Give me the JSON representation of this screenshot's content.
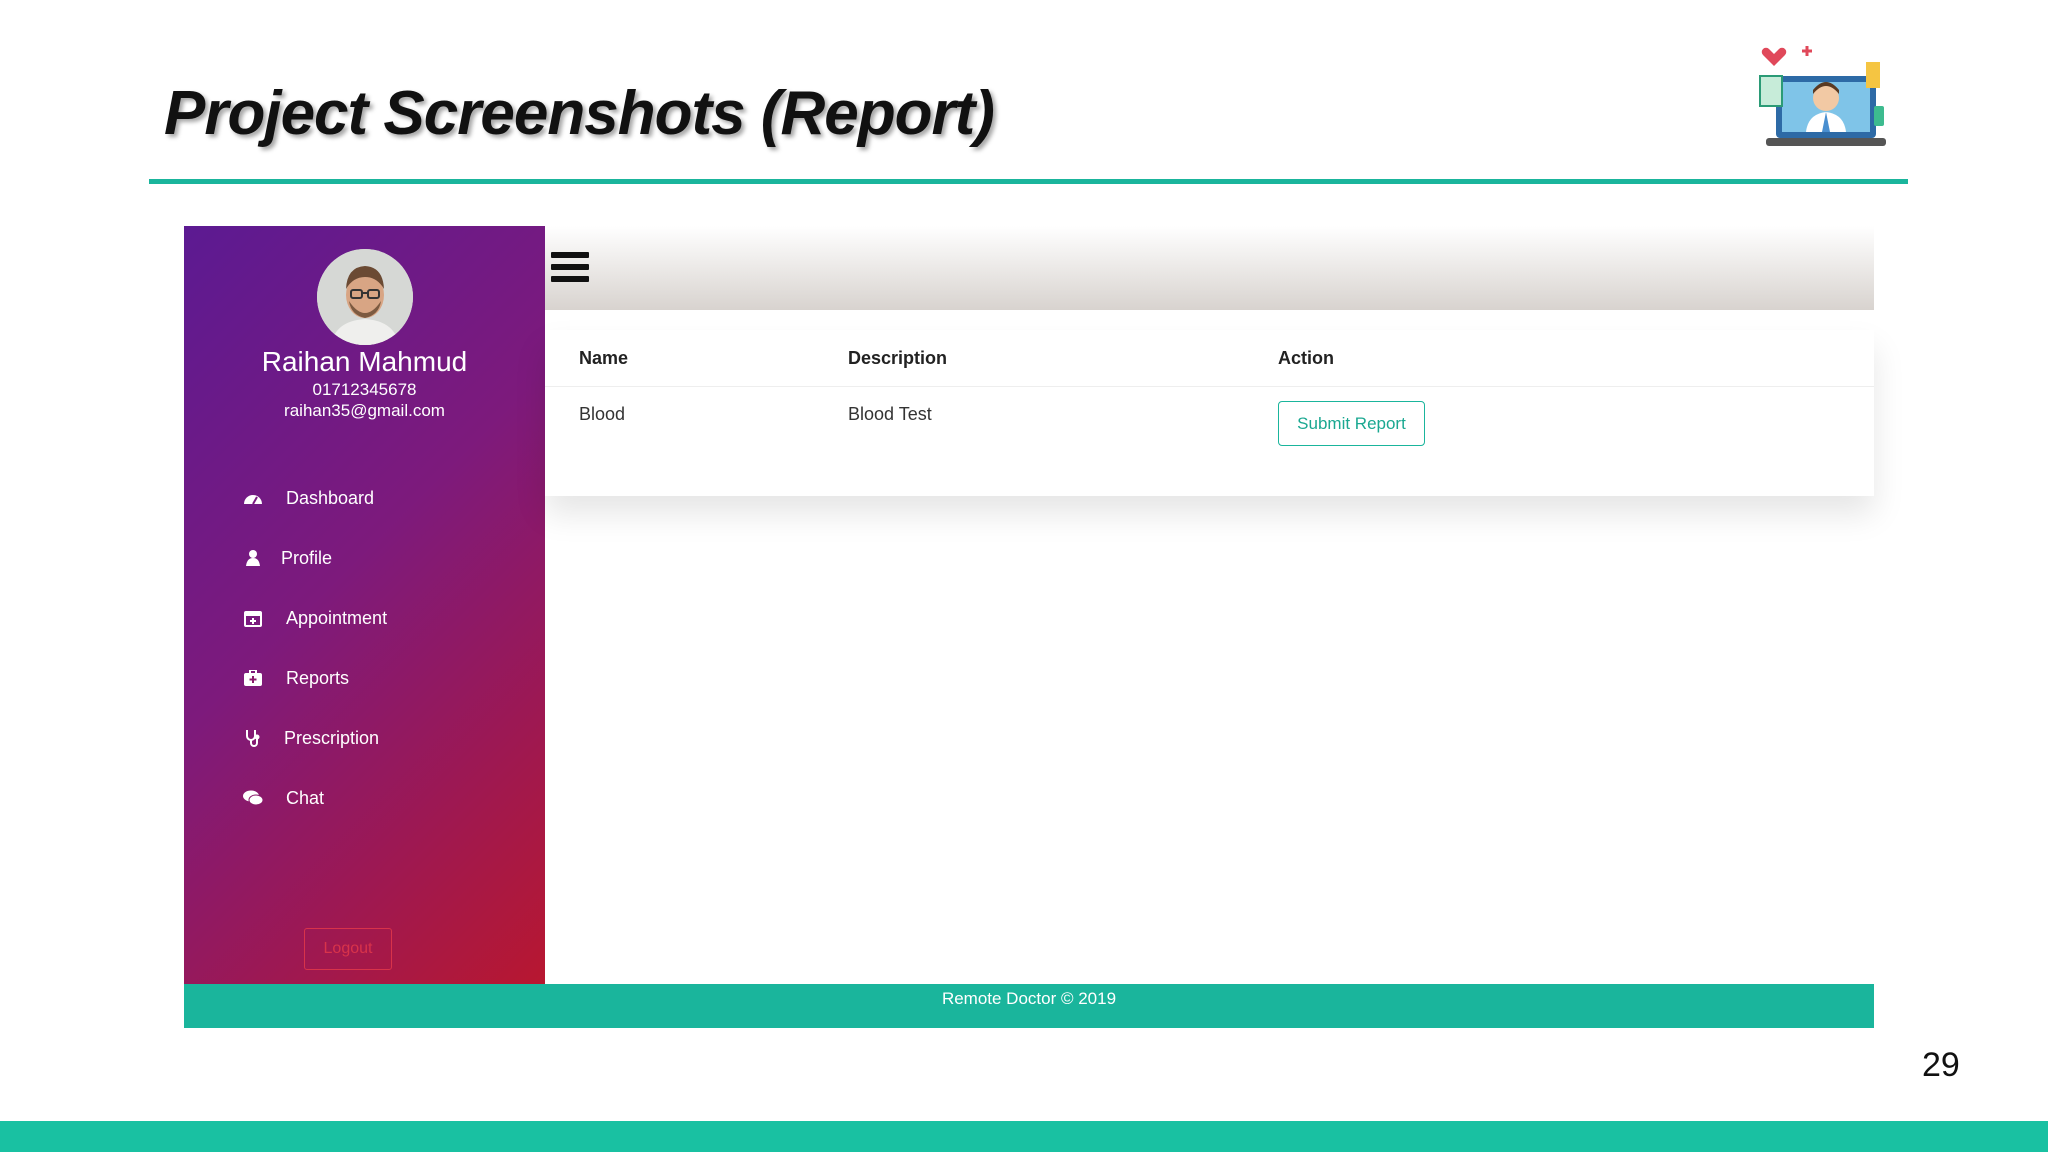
{
  "slide": {
    "title": "Project Screenshots (Report)",
    "page_number": "29"
  },
  "app": {
    "user": {
      "name": "Raihan Mahmud",
      "phone": "01712345678",
      "email": "raihan35@gmail.com"
    },
    "nav": [
      {
        "label": "Dashboard",
        "icon": "dashboard-icon"
      },
      {
        "label": "Profile",
        "icon": "user-icon"
      },
      {
        "label": "Appointment",
        "icon": "calendar-icon"
      },
      {
        "label": "Reports",
        "icon": "medkit-icon"
      },
      {
        "label": "Prescription",
        "icon": "stethoscope-icon"
      },
      {
        "label": "Chat",
        "icon": "chat-icon"
      }
    ],
    "logout_label": "Logout",
    "table": {
      "headers": [
        "Name",
        "Description",
        "Action"
      ],
      "rows": [
        {
          "name": "Blood",
          "description": "Blood Test",
          "action": "Submit Report"
        }
      ]
    },
    "footer_text": "Remote Doctor © 2019"
  },
  "colors": {
    "accent": "#1ab59c",
    "sidebar_start": "#5c1a92",
    "sidebar_end": "#b81730"
  }
}
